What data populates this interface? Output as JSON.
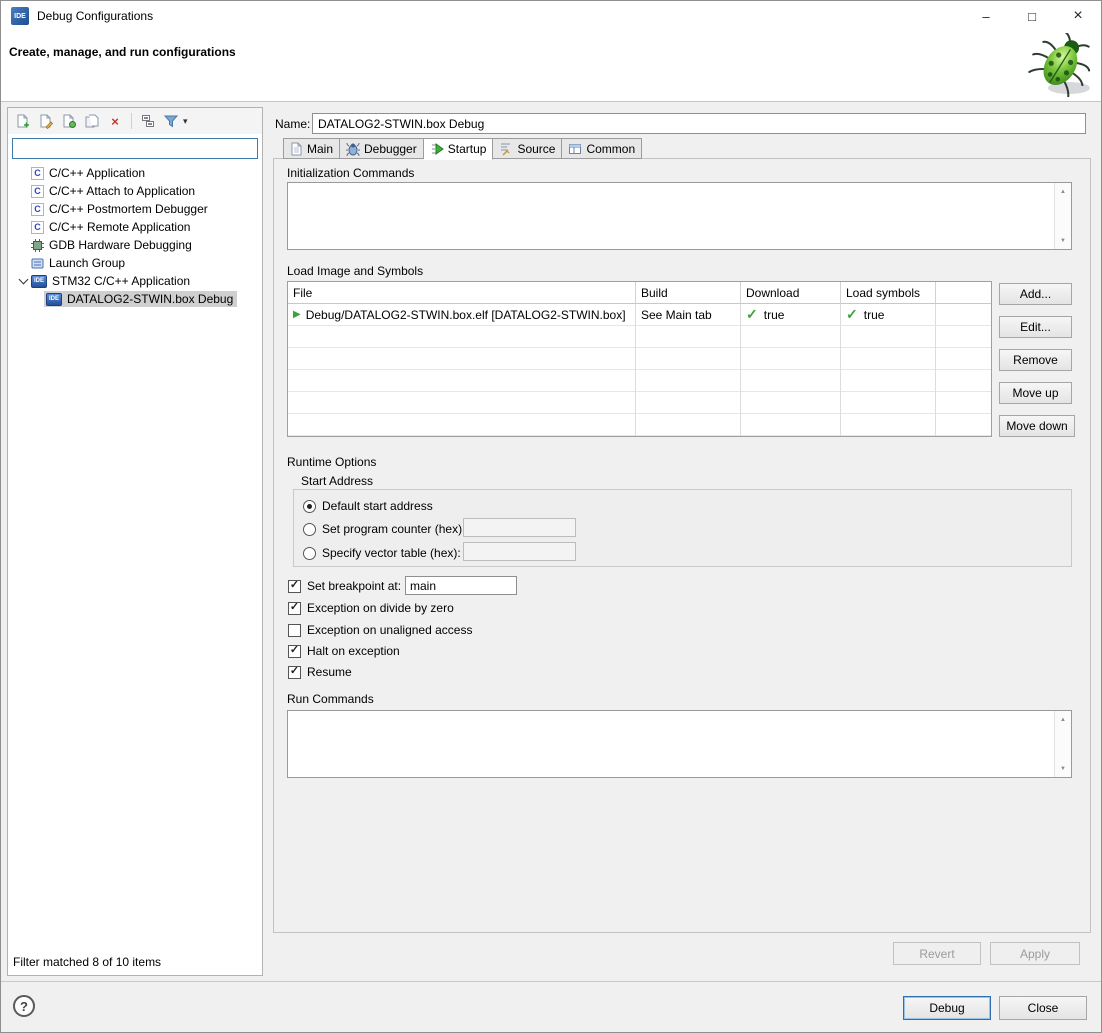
{
  "window": {
    "title": "Debug Configurations"
  },
  "header": {
    "title": "Create, manage, and run configurations"
  },
  "icons": {
    "minimize": "–",
    "maximize": "□",
    "close": "×",
    "delete_x": "×",
    "caret_down": "▾",
    "check": "✓",
    "play": "▶",
    "help": "?",
    "scroll_up": "▲",
    "scroll_down": "▼",
    "c_letter": "C",
    "ide_label": "IDE"
  },
  "left_panel": {
    "filter_value": "",
    "tree": [
      {
        "label": "C/C++ Application"
      },
      {
        "label": "C/C++ Attach to Application"
      },
      {
        "label": "C/C++ Postmortem Debugger"
      },
      {
        "label": "C/C++ Remote Application"
      },
      {
        "label": "GDB Hardware Debugging"
      },
      {
        "label": "Launch Group"
      },
      {
        "label": "STM32 C/C++ Application"
      },
      {
        "label": "DATALOG2-STWIN.box Debug"
      }
    ],
    "status": "Filter matched 8 of 10 items"
  },
  "form": {
    "name_label": "Name:",
    "name_value": "DATALOG2-STWIN.box Debug",
    "tabs": [
      {
        "label": "Main"
      },
      {
        "label": "Debugger"
      },
      {
        "label": "Startup"
      },
      {
        "label": "Source"
      },
      {
        "label": "Common"
      }
    ],
    "sections": {
      "init": "Initialization Commands",
      "load": "Load Image and Symbols",
      "runtime": "Runtime Options",
      "run": "Run Commands"
    },
    "table": {
      "headers": [
        "File",
        "Build",
        "Download",
        "Load symbols"
      ],
      "row": {
        "file": "Debug/DATALOG2-STWIN.box.elf [DATALOG2-STWIN.box]",
        "build": "See Main tab",
        "download": "true",
        "load_symbols": "true"
      }
    },
    "table_buttons": {
      "add": "Add...",
      "edit": "Edit...",
      "remove": "Remove",
      "move_up": "Move up",
      "move_down": "Move down"
    },
    "start_address": {
      "legend": "Start Address",
      "default_label": "Default start address",
      "pc_label": "Set program counter (hex):",
      "vector_label": "Specify vector table (hex):",
      "pc_value": "",
      "vector_value": ""
    },
    "options": {
      "breakpoint_label": "Set breakpoint at:",
      "breakpoint_value": "main",
      "divide_label": "Exception on divide by zero",
      "unaligned_label": "Exception on unaligned access",
      "halt_label": "Halt on exception",
      "resume_label": "Resume"
    },
    "revert": "Revert",
    "apply": "Apply"
  },
  "footer": {
    "debug": "Debug",
    "close": "Close"
  }
}
